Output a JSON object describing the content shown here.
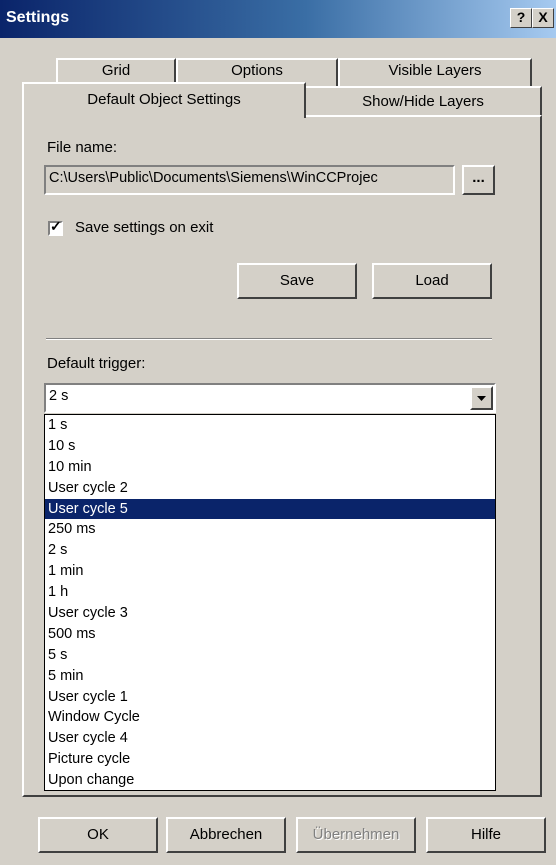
{
  "window": {
    "title": "Settings",
    "help_button": "?",
    "close_button": "X"
  },
  "tabs": {
    "row_back": [
      "Grid",
      "Options",
      "Visible Layers"
    ],
    "row_front": [
      "Default Object Settings",
      "Show/Hide Layers"
    ],
    "active": "Default Object Settings"
  },
  "file": {
    "label": "File name:",
    "value": "C:\\Users\\Public\\Documents\\Siemens\\WinCCProjec",
    "browse_label": "..."
  },
  "save_on_exit": {
    "label": "Save settings on exit",
    "checked": true
  },
  "actions": {
    "save_label": "Save",
    "load_label": "Load"
  },
  "trigger": {
    "label": "Default trigger:",
    "selected_value": "2 s",
    "highlighted": "User cycle 5",
    "options": [
      "1 s",
      "10 s",
      "10 min",
      "User cycle 2",
      "User cycle 5",
      "250 ms",
      "2 s",
      "1 min",
      "1 h",
      "User cycle 3",
      "500 ms",
      "5 s",
      "5 min",
      "User cycle 1",
      "Window Cycle",
      "User cycle 4",
      "Picture cycle",
      "Upon change"
    ]
  },
  "footer": {
    "ok_label": "OK",
    "cancel_label": "Abbrechen",
    "apply_label": "Übernehmen",
    "help_label": "Hilfe"
  }
}
